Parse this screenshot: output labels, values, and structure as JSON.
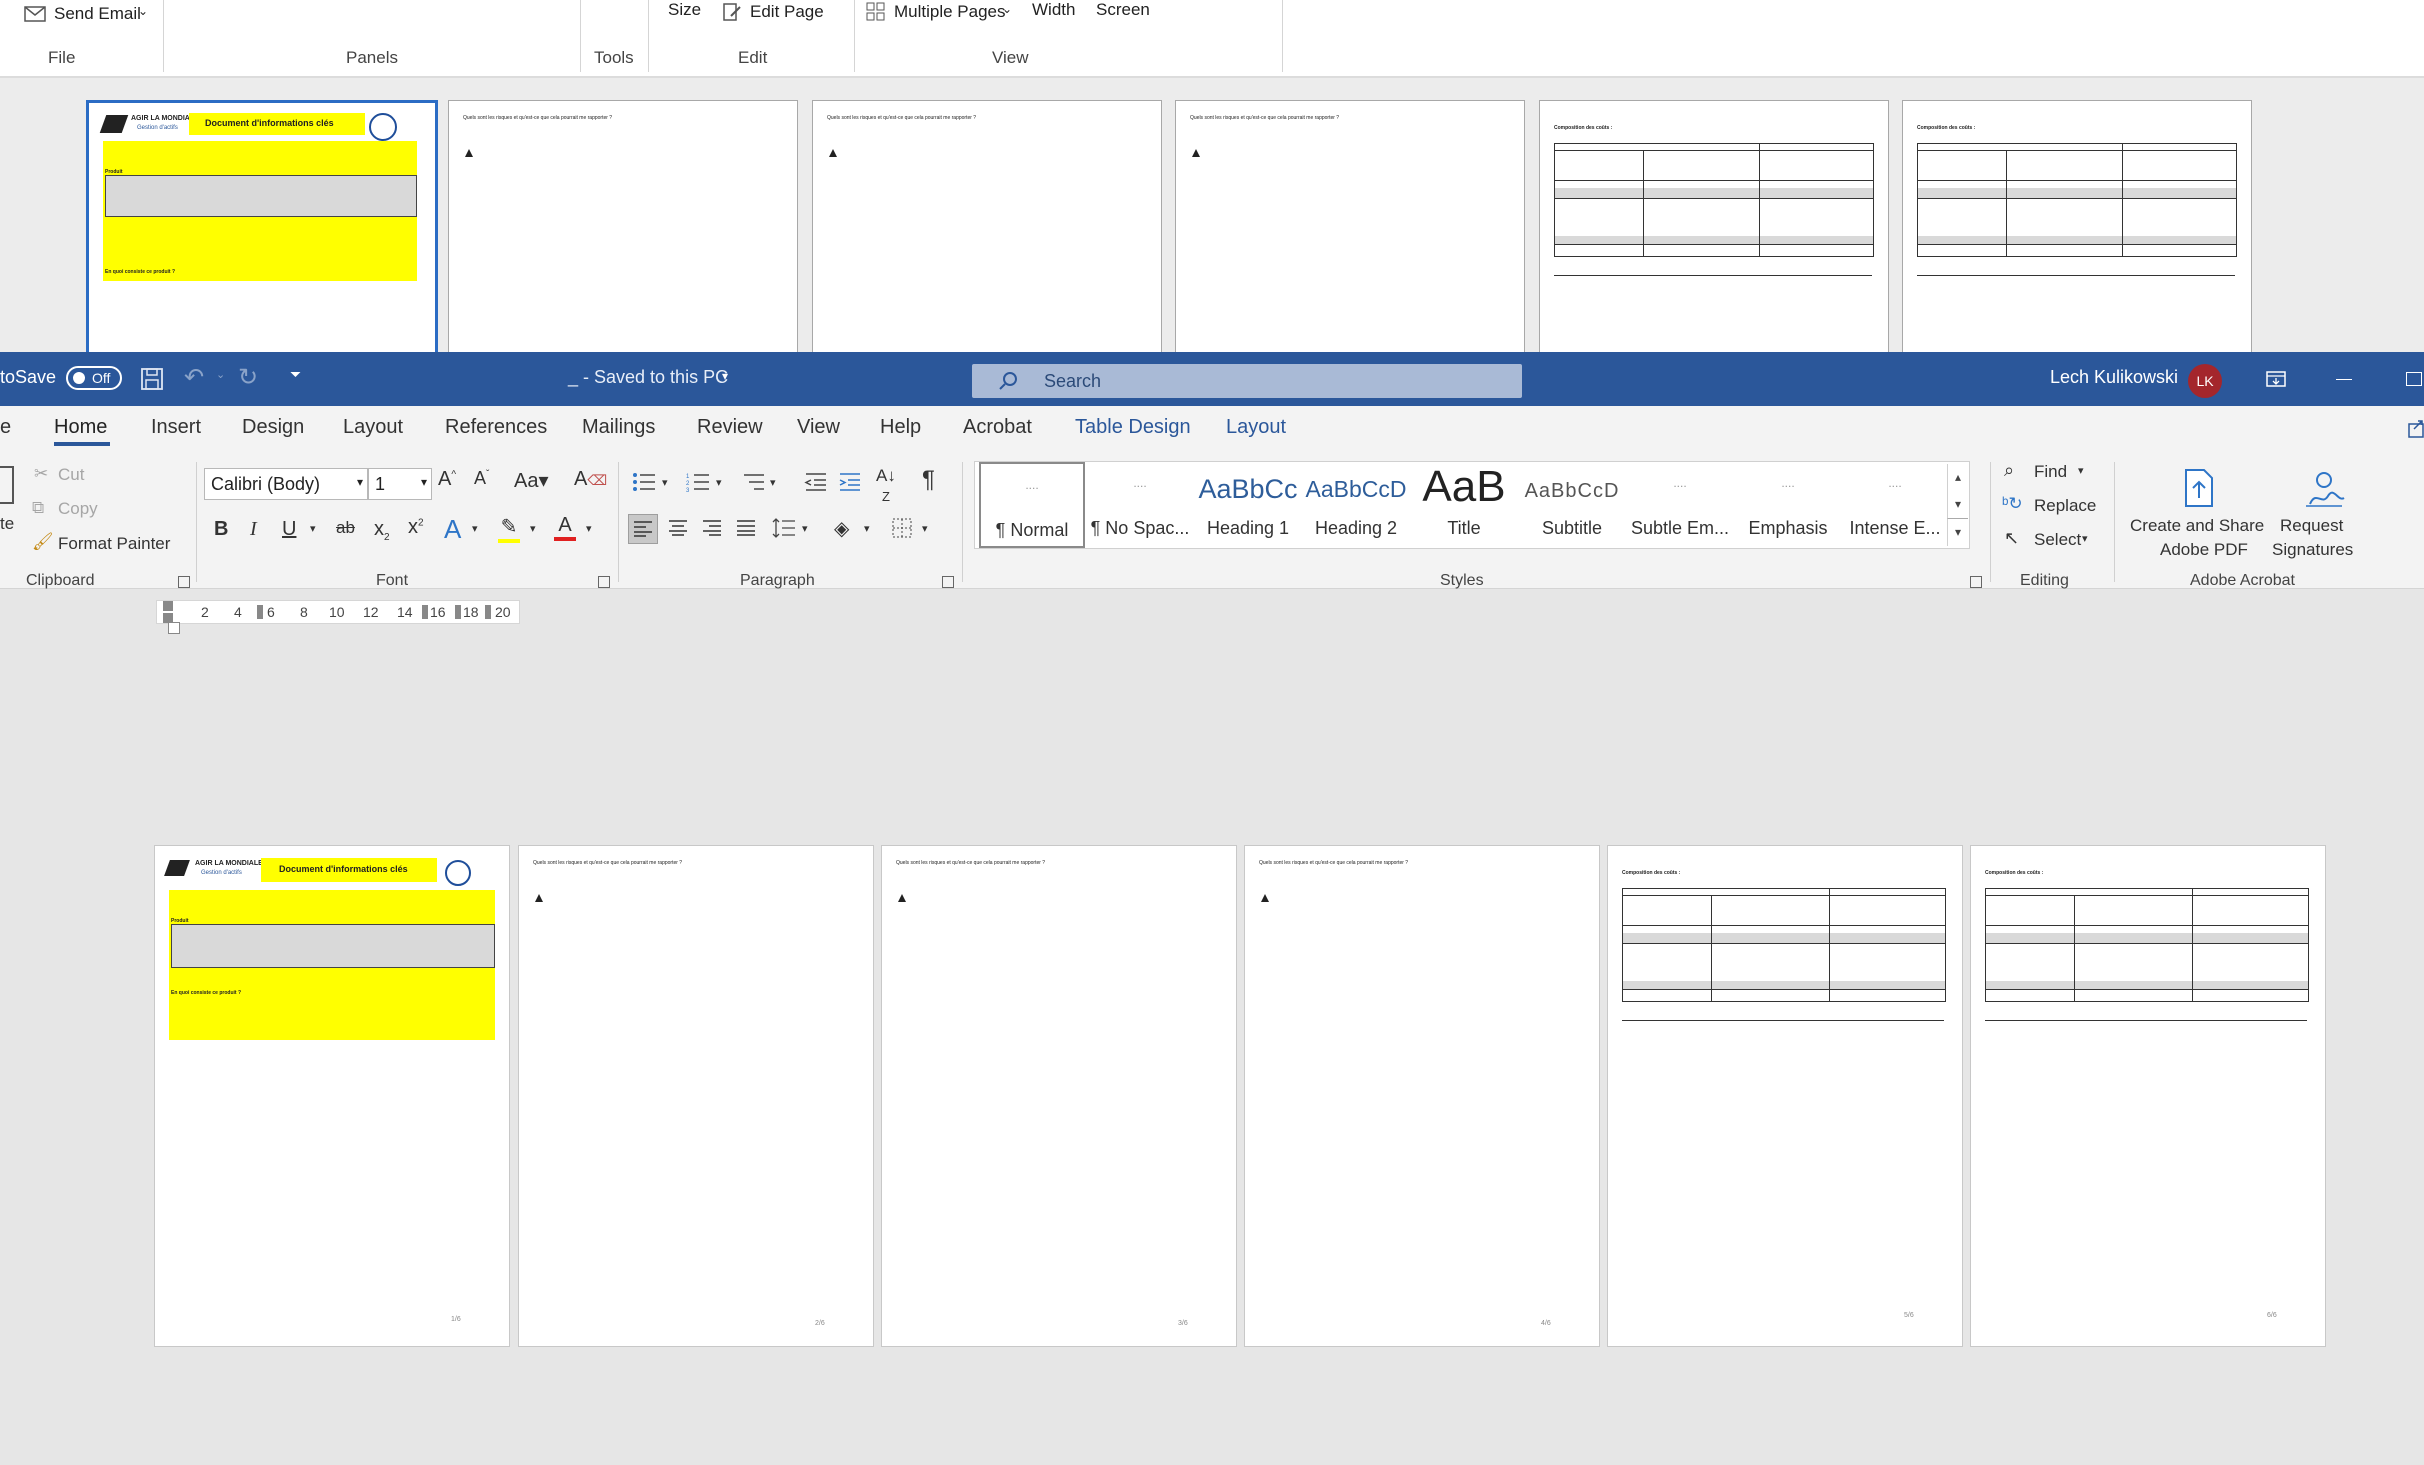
{
  "pdf_viewer": {
    "toolbar": {
      "send_email": "Send Email",
      "size": "Size",
      "edit_page": "Edit Page",
      "multiple_pages": "Multiple Pages",
      "width": "Width",
      "screen": "Screen",
      "groups": [
        "File",
        "Panels",
        "Tools",
        "Edit",
        "View"
      ]
    },
    "doc1": {
      "company": "AGIR LA MONDIALE",
      "subtitle": "Gestion d'actifs",
      "title": "Document d'informations clés",
      "produit_label": "Produit",
      "question": "En quoi consiste ce produit ?"
    },
    "page_prompt": "Quels sont les risques et qu'est-ce que cela pourrait me rapporter ?",
    "composition_label": "Composition des coûts :"
  },
  "word": {
    "titlebar": {
      "autosave": "toSave",
      "toggle": "Off",
      "doc_title": "_ - Saved to this PC",
      "search_placeholder": "Search",
      "user_name": "Lech Kulikowski",
      "user_initials": "LK"
    },
    "tabs": [
      "e",
      "Home",
      "Insert",
      "Design",
      "Layout",
      "References",
      "Mailings",
      "Review",
      "View",
      "Help",
      "Acrobat",
      "Table Design",
      "Layout"
    ],
    "clipboard": {
      "paste": "te",
      "cut": "Cut",
      "copy": "Copy",
      "format_painter": "Format Painter",
      "group": "Clipboard"
    },
    "font": {
      "family": "Calibri (Body)",
      "size": "1",
      "group": "Font"
    },
    "paragraph": {
      "group": "Paragraph"
    },
    "styles": {
      "group": "Styles",
      "items": [
        {
          "preview": "....",
          "name": "¶ Normal"
        },
        {
          "preview": "....",
          "name": "¶ No Spac..."
        },
        {
          "preview": "AaBbCc",
          "name": "Heading 1"
        },
        {
          "preview": "AaBbCcD",
          "name": "Heading 2"
        },
        {
          "preview": "AaB",
          "name": "Title"
        },
        {
          "preview": "AaBbCcD",
          "name": "Subtitle"
        },
        {
          "preview": "....",
          "name": "Subtle Em..."
        },
        {
          "preview": "....",
          "name": "Emphasis"
        },
        {
          "preview": "....",
          "name": "Intense E..."
        }
      ]
    },
    "editing": {
      "find": "Find",
      "replace": "Replace",
      "select": "Select",
      "group": "Editing"
    },
    "acrobat": {
      "create_line1": "Create and Share",
      "create_line2": "Adobe PDF",
      "request_line1": "Request",
      "request_line2": "Signatures",
      "group": "Adobe Acrobat"
    },
    "ruler_ticks": [
      "2",
      "4",
      "6",
      "8",
      "10",
      "12",
      "14",
      "16",
      "18",
      "20"
    ],
    "page_numbers": [
      "1/6",
      "2/6",
      "3/6",
      "4/6",
      "5/6",
      "6/6"
    ]
  },
  "colors": {
    "word_blue": "#2b579a",
    "highlight_yellow": "#ffff00",
    "avatar_red": "#a4262c"
  }
}
